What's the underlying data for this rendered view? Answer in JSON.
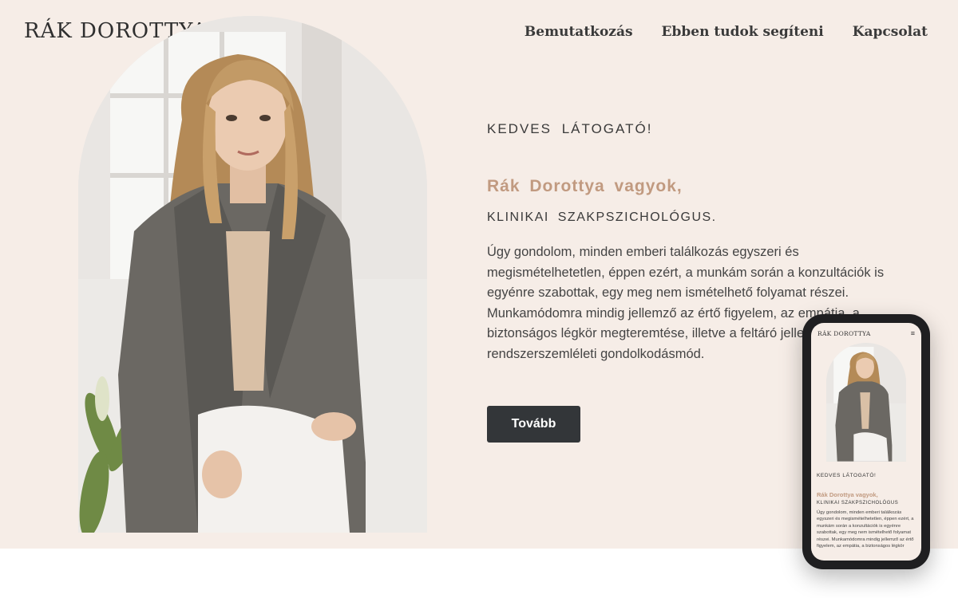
{
  "brand": {
    "logo": "RÁK DOROTTYA"
  },
  "nav": {
    "items": [
      {
        "label": "Bemutatkozás"
      },
      {
        "label": "Ebben tudok segíteni"
      },
      {
        "label": "Kapcsolat"
      }
    ]
  },
  "hero": {
    "greeting": "KEDVES   LÁTOGATÓ!",
    "name_line": "Rák  Dorottya  vagyok,",
    "role": "KLINIKAI   SZAKPSZICHOLÓGUS.",
    "description": "Úgy gondolom, minden emberi találkozás egyszeri és megismételhetetlen, éppen ezért, a munkám során a konzultációk is egyénre szabottak, egy meg nem ismételhető folyamat részei. Munkamódomra mindig jellemző az értő figyelem, az empátia, a biztonságos légkör megteremtése, illetve a feltáró jellegű, rendszerszemléleti gondolkodásmód.",
    "button": "Tovább"
  },
  "mobile_preview": {
    "logo": "RÁK DOROTTYA",
    "menu_icon": "≡",
    "greeting": "KEDVES   LÁTOGATÓ!",
    "name_line": "Rák  Dorottya  vagyok,",
    "role": "KLINIKAI   SZAKPSZICHOLÓGUS",
    "description": "Úgy gondolom, minden emberi találkozás egyszeri és megismételhetetlen, éppen ezért, a munkám során a konzultációk is egyénre szabottak, egy meg nem ismételhető folyamat részei. Munkamódomra mindig jellemző az értő figyelem, az empátia, a biztonságos légkör"
  },
  "colors": {
    "background": "#f6ede7",
    "accent": "#c19a80",
    "button": "#333639",
    "text": "#3a3a3a"
  }
}
